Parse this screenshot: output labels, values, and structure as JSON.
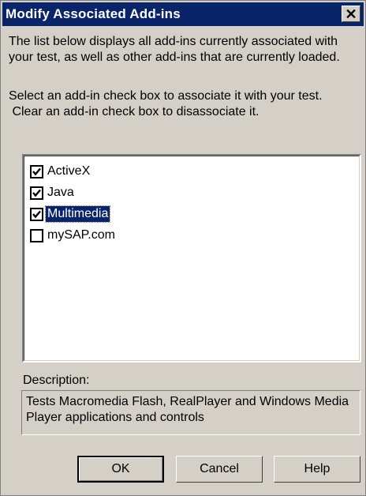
{
  "dialog": {
    "title": "Modify Associated Add-ins",
    "close_glyph": "✕"
  },
  "intro": "The list below displays all add-ins currently associated with your test, as well as other add-ins that are currently loaded.",
  "instructions": {
    "line1": "Select an add-in check box to associate it with your test.",
    "line2": " Clear an add-in check box to disassociate it."
  },
  "addins": [
    {
      "label": "ActiveX",
      "checked": true,
      "selected": false
    },
    {
      "label": "Java",
      "checked": true,
      "selected": false
    },
    {
      "label": "Multimedia",
      "checked": true,
      "selected": true
    },
    {
      "label": "mySAP.com",
      "checked": false,
      "selected": false
    }
  ],
  "description": {
    "label": "Description:",
    "text": "Tests Macromedia Flash, RealPlayer and Windows Media Player applications and controls"
  },
  "buttons": {
    "ok": "OK",
    "cancel": "Cancel",
    "help": "Help"
  },
  "colors": {
    "titlebar": "#0a246a",
    "face": "#d4d0c8",
    "selection": "#0a246a"
  }
}
